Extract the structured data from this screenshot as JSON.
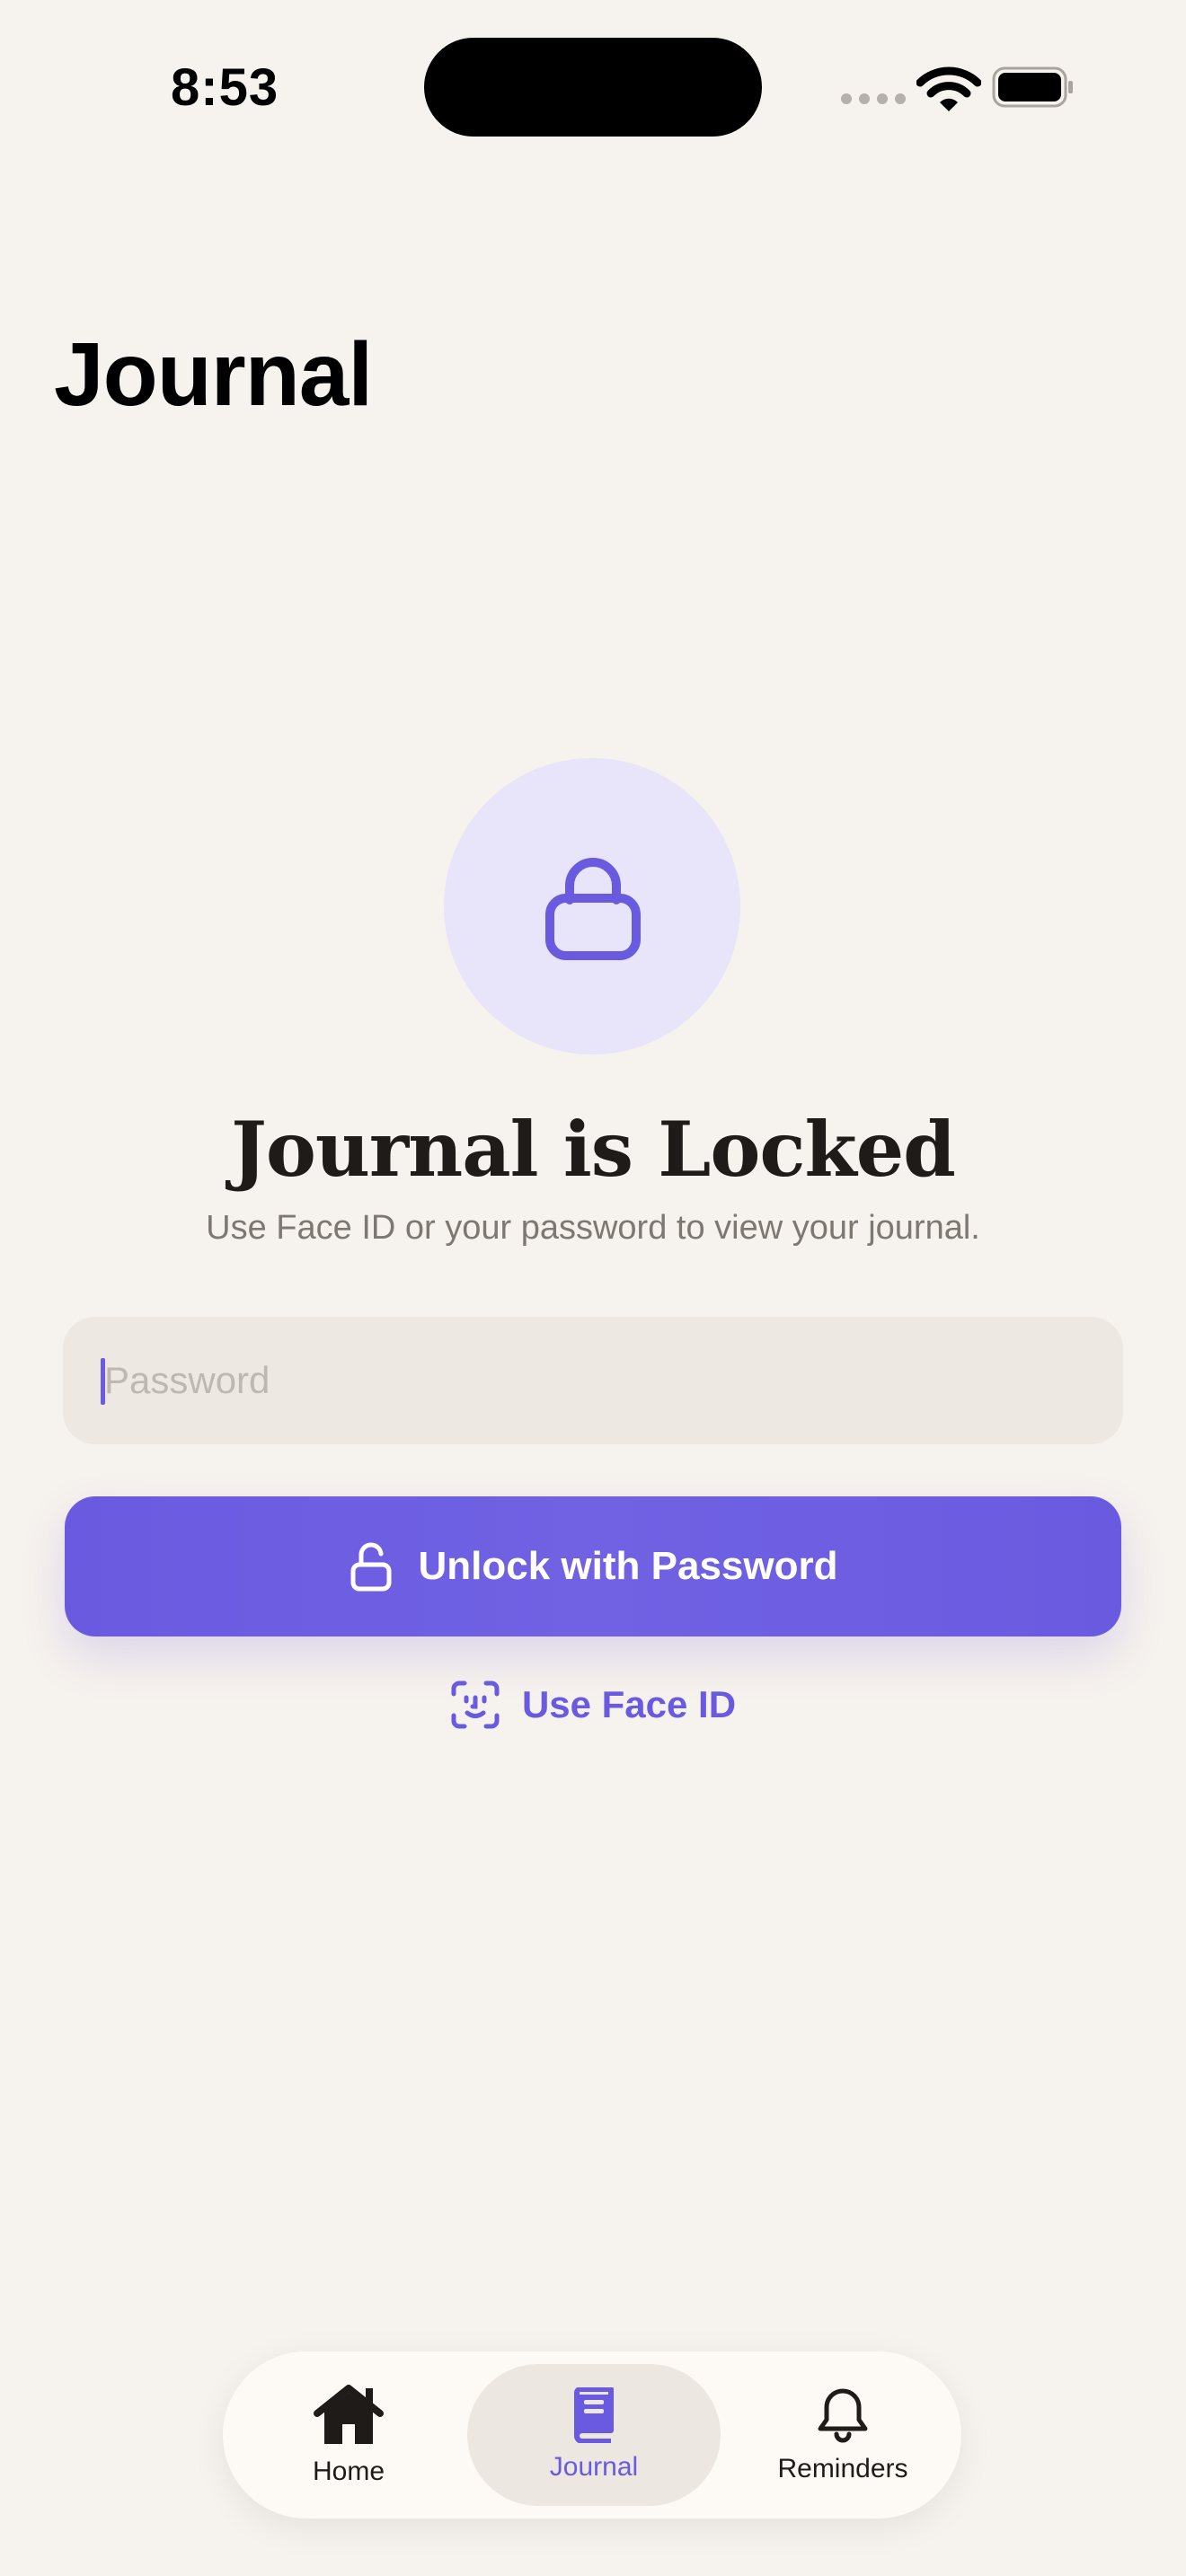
{
  "status_bar": {
    "time": "8:53"
  },
  "header": {
    "title": "Journal"
  },
  "lock_screen": {
    "icon": "lock-icon",
    "title": "Journal is Locked",
    "subtitle": "Use Face ID or your password to view your journal.",
    "password_field": {
      "placeholder": "Password",
      "value": ""
    },
    "unlock_button_label": "Unlock with Password",
    "faceid_label": "Use Face ID"
  },
  "tab_bar": {
    "items": [
      {
        "label": "Home",
        "icon": "house-icon",
        "selected": false
      },
      {
        "label": "Journal",
        "icon": "book-icon",
        "selected": true
      },
      {
        "label": "Reminders",
        "icon": "bell-icon",
        "selected": false
      }
    ]
  },
  "colors": {
    "background": "#F6F2ED",
    "accent": "#6A5AE0",
    "lock_circle": "#E8E4FA",
    "field_background": "#EDE8E2"
  }
}
